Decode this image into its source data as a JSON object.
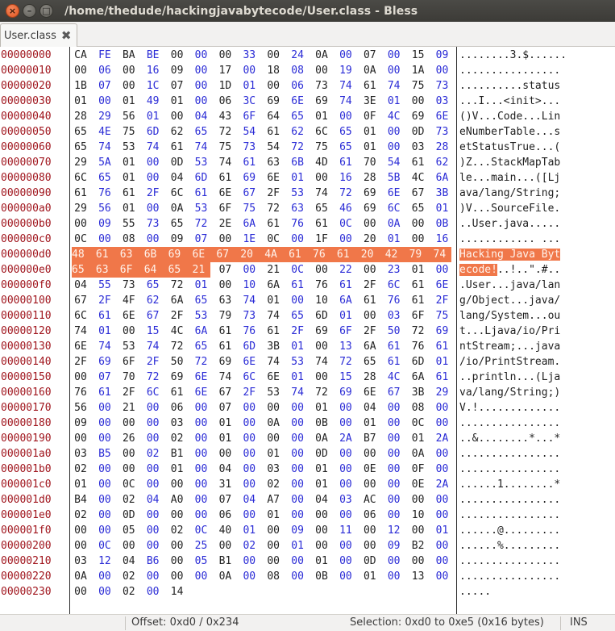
{
  "window": {
    "title": "/home/thedude/hackingjavabytecode/User.class - Bless",
    "buttons": {
      "close": "×",
      "minimize": "–",
      "maximize": "□"
    }
  },
  "tab": {
    "label": "User.class",
    "close_glyph": "✖"
  },
  "selection_range": {
    "start": "0xd0",
    "end_inclusive": "0xe5"
  },
  "hex_rows": [
    {
      "offset": "00000000",
      "bytes": [
        "CA",
        "FE",
        "BA",
        "BE",
        "00",
        "00",
        "00",
        "33",
        "00",
        "24",
        "0A",
        "00",
        "07",
        "00",
        "15",
        "09"
      ],
      "ascii": "........3.$......"
    },
    {
      "offset": "00000010",
      "bytes": [
        "00",
        "06",
        "00",
        "16",
        "09",
        "00",
        "17",
        "00",
        "18",
        "08",
        "00",
        "19",
        "0A",
        "00",
        "1A",
        "00"
      ],
      "ascii": "................"
    },
    {
      "offset": "00000020",
      "bytes": [
        "1B",
        "07",
        "00",
        "1C",
        "07",
        "00",
        "1D",
        "01",
        "00",
        "06",
        "73",
        "74",
        "61",
        "74",
        "75",
        "73"
      ],
      "ascii": "..........status"
    },
    {
      "offset": "00000030",
      "bytes": [
        "01",
        "00",
        "01",
        "49",
        "01",
        "00",
        "06",
        "3C",
        "69",
        "6E",
        "69",
        "74",
        "3E",
        "01",
        "00",
        "03"
      ],
      "ascii": "...I...<init>..."
    },
    {
      "offset": "00000040",
      "bytes": [
        "28",
        "29",
        "56",
        "01",
        "00",
        "04",
        "43",
        "6F",
        "64",
        "65",
        "01",
        "00",
        "0F",
        "4C",
        "69",
        "6E"
      ],
      "ascii": "()V...Code...Lin"
    },
    {
      "offset": "00000050",
      "bytes": [
        "65",
        "4E",
        "75",
        "6D",
        "62",
        "65",
        "72",
        "54",
        "61",
        "62",
        "6C",
        "65",
        "01",
        "00",
        "0D",
        "73"
      ],
      "ascii": "eNumberTable...s"
    },
    {
      "offset": "00000060",
      "bytes": [
        "65",
        "74",
        "53",
        "74",
        "61",
        "74",
        "75",
        "73",
        "54",
        "72",
        "75",
        "65",
        "01",
        "00",
        "03",
        "28"
      ],
      "ascii": "etStatusTrue...("
    },
    {
      "offset": "00000070",
      "bytes": [
        "29",
        "5A",
        "01",
        "00",
        "0D",
        "53",
        "74",
        "61",
        "63",
        "6B",
        "4D",
        "61",
        "70",
        "54",
        "61",
        "62"
      ],
      "ascii": ")Z...StackMapTab"
    },
    {
      "offset": "00000080",
      "bytes": [
        "6C",
        "65",
        "01",
        "00",
        "04",
        "6D",
        "61",
        "69",
        "6E",
        "01",
        "00",
        "16",
        "28",
        "5B",
        "4C",
        "6A"
      ],
      "ascii": "le...main...([Lj"
    },
    {
      "offset": "00000090",
      "bytes": [
        "61",
        "76",
        "61",
        "2F",
        "6C",
        "61",
        "6E",
        "67",
        "2F",
        "53",
        "74",
        "72",
        "69",
        "6E",
        "67",
        "3B"
      ],
      "ascii": "ava/lang/String;"
    },
    {
      "offset": "000000a0",
      "bytes": [
        "29",
        "56",
        "01",
        "00",
        "0A",
        "53",
        "6F",
        "75",
        "72",
        "63",
        "65",
        "46",
        "69",
        "6C",
        "65",
        "01"
      ],
      "ascii": ")V...SourceFile."
    },
    {
      "offset": "000000b0",
      "bytes": [
        "00",
        "09",
        "55",
        "73",
        "65",
        "72",
        "2E",
        "6A",
        "61",
        "76",
        "61",
        "0C",
        "00",
        "0A",
        "00",
        "0B"
      ],
      "ascii": "..User.java....."
    },
    {
      "offset": "000000c0",
      "bytes": [
        "0C",
        "00",
        "08",
        "00",
        "09",
        "07",
        "00",
        "1E",
        "0C",
        "00",
        "1F",
        "00",
        "20",
        "01",
        "00",
        "16"
      ],
      "ascii": "............ ..."
    },
    {
      "offset": "000000d0",
      "bytes": [
        "48",
        "61",
        "63",
        "6B",
        "69",
        "6E",
        "67",
        "20",
        "4A",
        "61",
        "76",
        "61",
        "20",
        "42",
        "79",
        "74"
      ],
      "ascii": "Hacking Java Byt"
    },
    {
      "offset": "000000e0",
      "bytes": [
        "65",
        "63",
        "6F",
        "64",
        "65",
        "21",
        "07",
        "00",
        "21",
        "0C",
        "00",
        "22",
        "00",
        "23",
        "01",
        "00"
      ],
      "ascii": "ecode!..!..\".#.."
    },
    {
      "offset": "000000f0",
      "bytes": [
        "04",
        "55",
        "73",
        "65",
        "72",
        "01",
        "00",
        "10",
        "6A",
        "61",
        "76",
        "61",
        "2F",
        "6C",
        "61",
        "6E"
      ],
      "ascii": ".User...java/lan"
    },
    {
      "offset": "00000100",
      "bytes": [
        "67",
        "2F",
        "4F",
        "62",
        "6A",
        "65",
        "63",
        "74",
        "01",
        "00",
        "10",
        "6A",
        "61",
        "76",
        "61",
        "2F"
      ],
      "ascii": "g/Object...java/"
    },
    {
      "offset": "00000110",
      "bytes": [
        "6C",
        "61",
        "6E",
        "67",
        "2F",
        "53",
        "79",
        "73",
        "74",
        "65",
        "6D",
        "01",
        "00",
        "03",
        "6F",
        "75"
      ],
      "ascii": "lang/System...ou"
    },
    {
      "offset": "00000120",
      "bytes": [
        "74",
        "01",
        "00",
        "15",
        "4C",
        "6A",
        "61",
        "76",
        "61",
        "2F",
        "69",
        "6F",
        "2F",
        "50",
        "72",
        "69"
      ],
      "ascii": "t...Ljava/io/Pri"
    },
    {
      "offset": "00000130",
      "bytes": [
        "6E",
        "74",
        "53",
        "74",
        "72",
        "65",
        "61",
        "6D",
        "3B",
        "01",
        "00",
        "13",
        "6A",
        "61",
        "76",
        "61"
      ],
      "ascii": "ntStream;...java"
    },
    {
      "offset": "00000140",
      "bytes": [
        "2F",
        "69",
        "6F",
        "2F",
        "50",
        "72",
        "69",
        "6E",
        "74",
        "53",
        "74",
        "72",
        "65",
        "61",
        "6D",
        "01"
      ],
      "ascii": "/io/PrintStream."
    },
    {
      "offset": "00000150",
      "bytes": [
        "00",
        "07",
        "70",
        "72",
        "69",
        "6E",
        "74",
        "6C",
        "6E",
        "01",
        "00",
        "15",
        "28",
        "4C",
        "6A",
        "61"
      ],
      "ascii": "..println...(Lja"
    },
    {
      "offset": "00000160",
      "bytes": [
        "76",
        "61",
        "2F",
        "6C",
        "61",
        "6E",
        "67",
        "2F",
        "53",
        "74",
        "72",
        "69",
        "6E",
        "67",
        "3B",
        "29"
      ],
      "ascii": "va/lang/String;)"
    },
    {
      "offset": "00000170",
      "bytes": [
        "56",
        "00",
        "21",
        "00",
        "06",
        "00",
        "07",
        "00",
        "00",
        "00",
        "01",
        "00",
        "04",
        "00",
        "08",
        "00"
      ],
      "ascii": "V.!............."
    },
    {
      "offset": "00000180",
      "bytes": [
        "09",
        "00",
        "00",
        "00",
        "03",
        "00",
        "01",
        "00",
        "0A",
        "00",
        "0B",
        "00",
        "01",
        "00",
        "0C",
        "00"
      ],
      "ascii": "................"
    },
    {
      "offset": "00000190",
      "bytes": [
        "00",
        "00",
        "26",
        "00",
        "02",
        "00",
        "01",
        "00",
        "00",
        "00",
        "0A",
        "2A",
        "B7",
        "00",
        "01",
        "2A"
      ],
      "ascii": "..&........*...*"
    },
    {
      "offset": "000001a0",
      "bytes": [
        "03",
        "B5",
        "00",
        "02",
        "B1",
        "00",
        "00",
        "00",
        "01",
        "00",
        "0D",
        "00",
        "00",
        "00",
        "0A",
        "00"
      ],
      "ascii": "................"
    },
    {
      "offset": "000001b0",
      "bytes": [
        "02",
        "00",
        "00",
        "00",
        "01",
        "00",
        "04",
        "00",
        "03",
        "00",
        "01",
        "00",
        "0E",
        "00",
        "0F",
        "00"
      ],
      "ascii": "................"
    },
    {
      "offset": "000001c0",
      "bytes": [
        "01",
        "00",
        "0C",
        "00",
        "00",
        "00",
        "31",
        "00",
        "02",
        "00",
        "01",
        "00",
        "00",
        "00",
        "0E",
        "2A"
      ],
      "ascii": "......1........*"
    },
    {
      "offset": "000001d0",
      "bytes": [
        "B4",
        "00",
        "02",
        "04",
        "A0",
        "00",
        "07",
        "04",
        "A7",
        "00",
        "04",
        "03",
        "AC",
        "00",
        "00",
        "00"
      ],
      "ascii": "................"
    },
    {
      "offset": "000001e0",
      "bytes": [
        "02",
        "00",
        "0D",
        "00",
        "00",
        "00",
        "06",
        "00",
        "01",
        "00",
        "00",
        "00",
        "06",
        "00",
        "10",
        "00"
      ],
      "ascii": "................"
    },
    {
      "offset": "000001f0",
      "bytes": [
        "00",
        "00",
        "05",
        "00",
        "02",
        "0C",
        "40",
        "01",
        "00",
        "09",
        "00",
        "11",
        "00",
        "12",
        "00",
        "01"
      ],
      "ascii": "......@........."
    },
    {
      "offset": "00000200",
      "bytes": [
        "00",
        "0C",
        "00",
        "00",
        "00",
        "25",
        "00",
        "02",
        "00",
        "01",
        "00",
        "00",
        "00",
        "09",
        "B2",
        "00"
      ],
      "ascii": "......%........."
    },
    {
      "offset": "00000210",
      "bytes": [
        "03",
        "12",
        "04",
        "B6",
        "00",
        "05",
        "B1",
        "00",
        "00",
        "00",
        "01",
        "00",
        "0D",
        "00",
        "00",
        "00"
      ],
      "ascii": "................"
    },
    {
      "offset": "00000220",
      "bytes": [
        "0A",
        "00",
        "02",
        "00",
        "00",
        "00",
        "0A",
        "00",
        "08",
        "00",
        "0B",
        "00",
        "01",
        "00",
        "13",
        "00"
      ],
      "ascii": "................"
    },
    {
      "offset": "00000230",
      "bytes": [
        "00",
        "00",
        "02",
        "00",
        "14"
      ],
      "ascii": "....."
    }
  ],
  "status": {
    "offset": "Offset: 0xd0 / 0x234",
    "selection": "Selection: 0xd0 to 0xe5 (0x16 bytes)",
    "mode": "INS"
  },
  "colors": {
    "offset_text": "#a0151d",
    "zero_byte": "#2a2bd6",
    "selection_bg": "#f07749",
    "titlebar_bg": "#3c3b37"
  }
}
